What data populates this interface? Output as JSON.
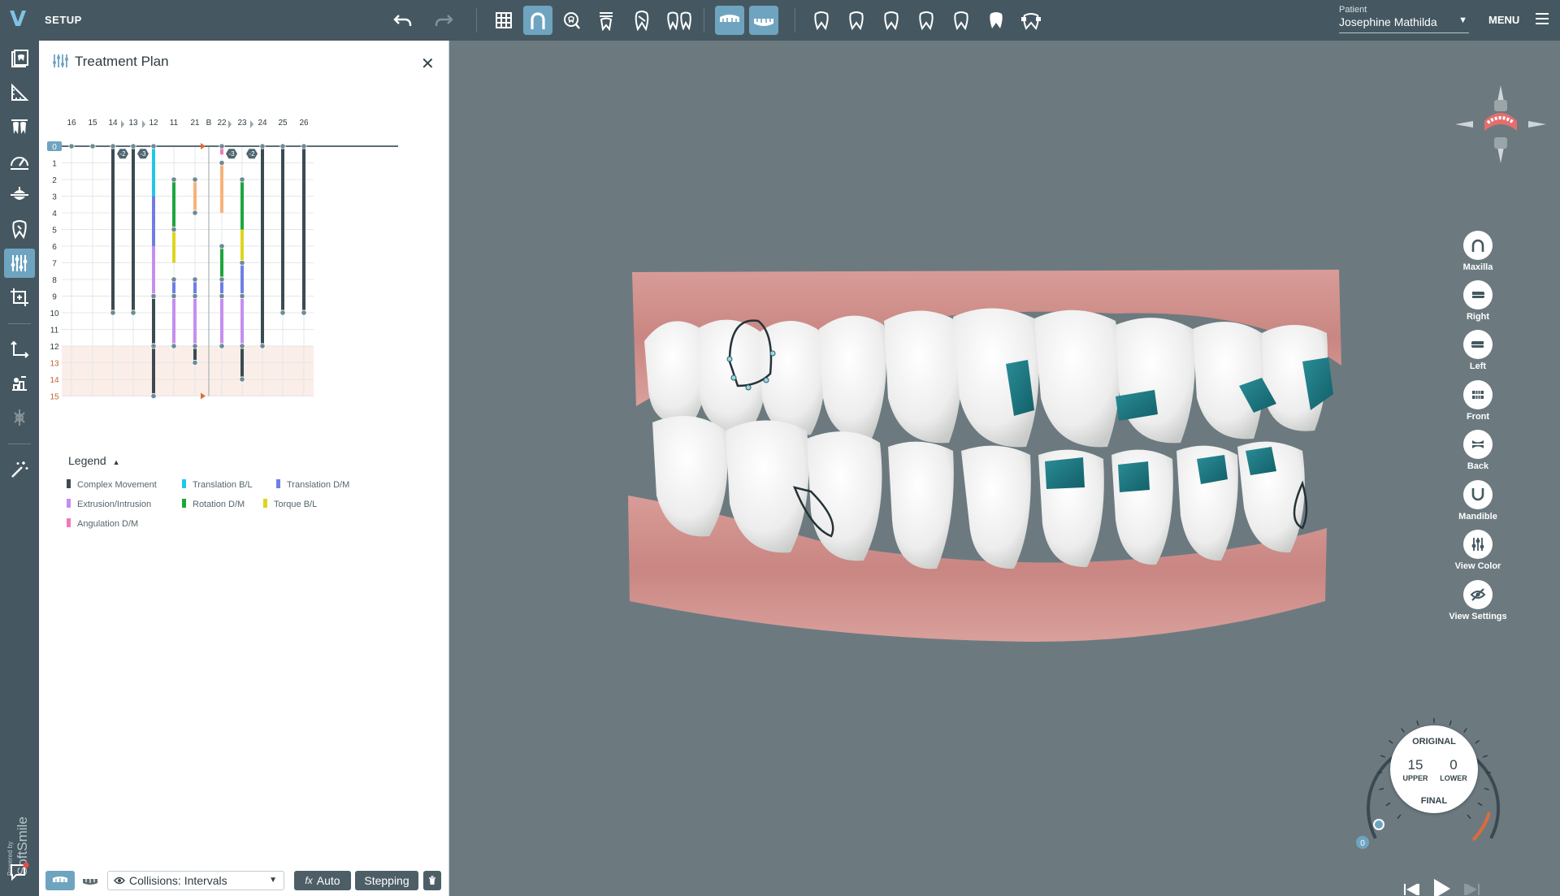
{
  "app": {
    "title": "SETUP",
    "logo": "V"
  },
  "patient": {
    "label": "Patient",
    "name": "Josephine Mathilda"
  },
  "menu": {
    "label": "MENU"
  },
  "panel": {
    "title": "Treatment Plan",
    "teeth": [
      "16",
      "15",
      "14",
      "13",
      "12",
      "11",
      "21",
      "B",
      "22",
      "23",
      "24",
      "25",
      "26"
    ],
    "steps": [
      "0",
      "1",
      "2",
      "3",
      "4",
      "5",
      "6",
      "7",
      "8",
      "9",
      "10",
      "11",
      "12",
      "13",
      "14",
      "15"
    ],
    "badges": [
      "-2",
      "-3",
      "-3",
      "-2"
    ],
    "legend_title": "Legend",
    "legend_caret": "▲",
    "legend": [
      {
        "label": "Complex Movement",
        "color": "#3c4a52"
      },
      {
        "label": "Translation B/L",
        "color": "#21c7e8"
      },
      {
        "label": "Translation D/M",
        "color": "#6f7ee6"
      },
      {
        "label": "Extrusion/Intrusion",
        "color": "#c58ef0"
      },
      {
        "label": "Rotation D/M",
        "color": "#1da73a"
      },
      {
        "label": "Torque B/L",
        "color": "#ddd51e"
      },
      {
        "label": "Angulation D/M",
        "color": "#f07ab8"
      }
    ],
    "footer": {
      "collisions": "Collisions: Intervals",
      "auto": "Auto",
      "auto_prefix": "fx",
      "stepping": "Stepping"
    }
  },
  "views": [
    {
      "label": "Maxilla",
      "icon": "maxilla-icon"
    },
    {
      "label": "Right",
      "icon": "right-view-icon"
    },
    {
      "label": "Left",
      "icon": "left-view-icon"
    },
    {
      "label": "Front",
      "icon": "front-view-icon"
    },
    {
      "label": "Back",
      "icon": "back-view-icon"
    },
    {
      "label": "Mandible",
      "icon": "mandible-icon"
    },
    {
      "label": "View Color",
      "icon": "sliders-icon"
    },
    {
      "label": "View Settings",
      "icon": "eye-slash-icon"
    }
  ],
  "dial": {
    "original": "ORIGINAL",
    "upper_value": "15",
    "upper_label": "UPPER",
    "lower_value": "0",
    "lower_label": "LOWER",
    "final": "FINAL",
    "marker": "0"
  },
  "powered_by": {
    "prefix": "Powered by",
    "brand": "SoftSmile"
  },
  "colors": {
    "topbar": "#455861",
    "accent": "#6fa4c0",
    "viewport": "#6c7a80"
  }
}
